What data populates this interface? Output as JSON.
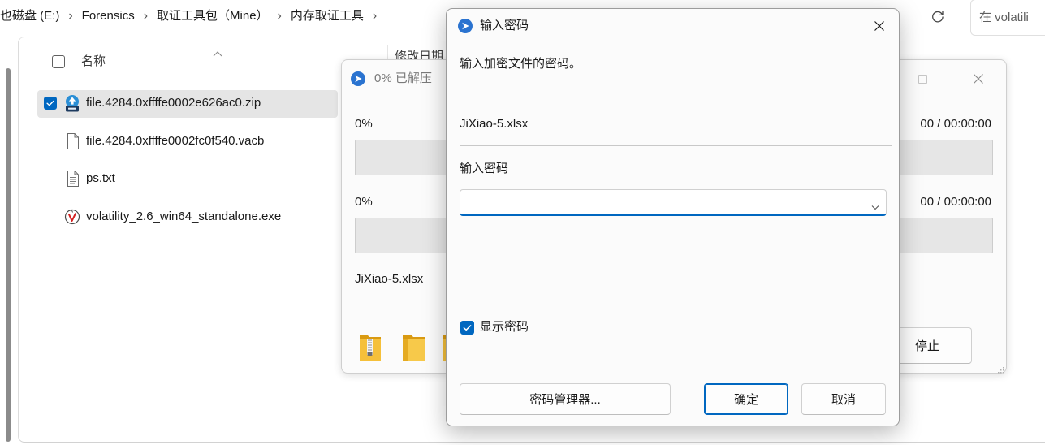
{
  "colors": {
    "accent": "#0067c0",
    "selected_row": "#e5e5e5"
  },
  "explorer": {
    "breadcrumb": [
      {
        "label": "也磁盘 (E:)"
      },
      {
        "label": "Forensics"
      },
      {
        "label": "取证工具包（Mine）"
      },
      {
        "label": "内存取证工具"
      }
    ],
    "separator": "›",
    "refresh_icon": "refresh-icon",
    "search_placeholder": "在 volatili",
    "columns": {
      "name": "名称",
      "modified": "修改日期",
      "sort_icon": "chevron-up-icon"
    },
    "files": [
      {
        "name": "file.4284.0xffffe0002e626ac0.zip",
        "icon": "zip-archive-icon",
        "selected": true
      },
      {
        "name": "file.4284.0xffffe0002fc0f540.vacb",
        "icon": "file-icon",
        "selected": false
      },
      {
        "name": "ps.txt",
        "icon": "text-file-icon",
        "selected": false
      },
      {
        "name": "volatility_2.6_win64_standalone.exe",
        "icon": "volatility-exe-icon",
        "selected": false
      }
    ]
  },
  "progress_dialog": {
    "title": "0% 已解压",
    "icon": "app-icon",
    "rows": [
      {
        "percent": "0%",
        "time": "00 / 00:00:00",
        "progress": 0
      },
      {
        "percent": "0%",
        "time": "00 / 00:00:00",
        "progress": 0
      }
    ],
    "current_file": "JiXiao-5.xlsx",
    "stop_label": "停止"
  },
  "password_dialog": {
    "title": "输入密码",
    "icon": "app-icon",
    "prompt": "输入加密文件的密码。",
    "file_name": "JiXiao-5.xlsx",
    "password_label": "输入密码",
    "password_value": "",
    "show_password_label": "显示密码",
    "show_password_checked": true,
    "buttons": {
      "manager": "密码管理器...",
      "ok": "确定",
      "cancel": "取消"
    }
  }
}
